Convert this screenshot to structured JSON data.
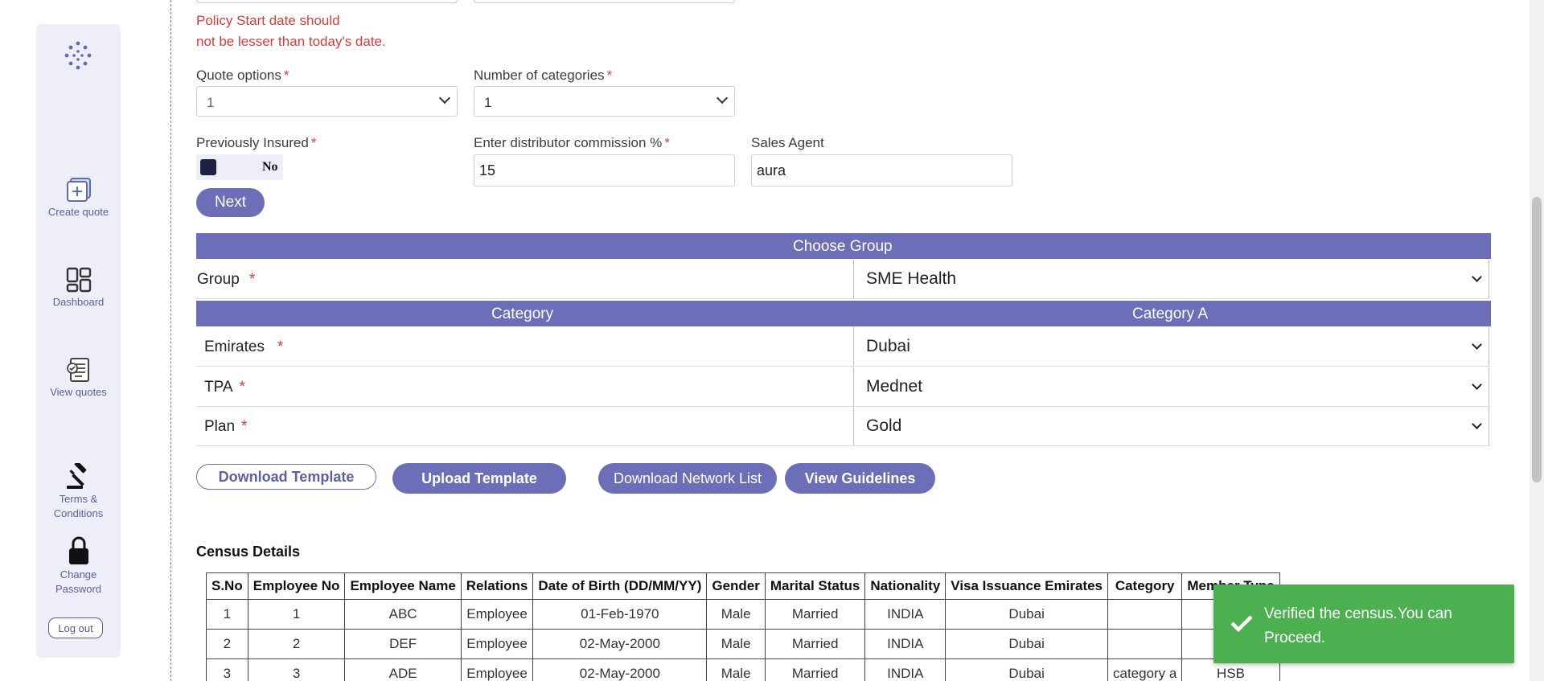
{
  "sidebar": {
    "logo_icon": "dots-logo-icon",
    "items": [
      {
        "label": "Create quote",
        "icon": "plus-square-icon"
      },
      {
        "label": "Dashboard",
        "icon": "grid-icon"
      },
      {
        "label": "View quotes",
        "icon": "document-check-icon"
      },
      {
        "label_line1": "Terms &",
        "label_line2": "Conditions",
        "icon": "gavel-icon"
      },
      {
        "label_line1": "Change",
        "label_line2": "Password",
        "icon": "lock-icon"
      }
    ],
    "logout_label": "Log out"
  },
  "form": {
    "error_line1": "Policy Start date should",
    "error_line2": "not be lesser than today's date.",
    "quote_options": {
      "label": "Quote options",
      "value": "1"
    },
    "num_categories": {
      "label": "Number of categories",
      "value": "1"
    },
    "previously_insured": {
      "label": "Previously Insured",
      "toggle_text": "No"
    },
    "commission": {
      "label": "Enter distributor commission %",
      "value": "15"
    },
    "sales_agent": {
      "label": "Sales Agent",
      "value": "aura"
    },
    "required_mark": "*",
    "next_label": "Next"
  },
  "group_table": {
    "header": "Choose Group",
    "group_label": "Group",
    "group_value": "SME Health",
    "category_header": "Category",
    "category_value_header": "Category A",
    "rows": [
      {
        "label": "Emirates",
        "value": "Dubai"
      },
      {
        "label": "TPA",
        "value": "Mednet"
      },
      {
        "label": "Plan",
        "value": "Gold"
      }
    ]
  },
  "actions": {
    "download_template": "Download Template",
    "upload_template": "Upload Template",
    "download_network": "Download Network List",
    "view_guidelines": "View Guidelines"
  },
  "census": {
    "title": "Census Details",
    "columns": [
      "S.No",
      "Employee No",
      "Employee Name",
      "Relations",
      "Date of Birth (DD/MM/YY)",
      "Gender",
      "Marital Status",
      "Nationality",
      "Visa Issuance Emirates",
      "Category",
      "Member Type"
    ],
    "rows": [
      [
        "1",
        "1",
        "ABC",
        "Employee",
        "01-Feb-1970",
        "Male",
        "Married",
        "INDIA",
        "Dubai",
        "",
        ""
      ],
      [
        "2",
        "2",
        "DEF",
        "Employee",
        "02-May-2000",
        "Male",
        "Married",
        "INDIA",
        "Dubai",
        "",
        ""
      ],
      [
        "3",
        "3",
        "ADE",
        "Employee",
        "02-May-2000",
        "Male",
        "Married",
        "INDIA",
        "Dubai",
        "category a",
        "HSB"
      ]
    ]
  },
  "toast": {
    "message": "Verified the census.You can Proceed.",
    "icon": "checkmark-icon",
    "color": "#4caf50"
  },
  "colors": {
    "accent": "#6c6fb8",
    "error": "#d93b3b",
    "sidebar_bg": "#eeeef8"
  }
}
